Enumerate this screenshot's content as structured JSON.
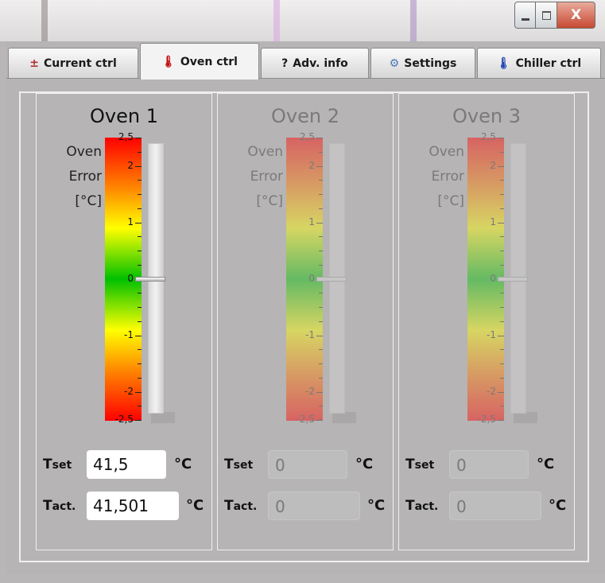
{
  "window": {
    "buttons": {
      "close_label": "X"
    }
  },
  "tabs": [
    {
      "label": "Current ctrl",
      "icon": "current-icon",
      "glyph": "±"
    },
    {
      "label": "Oven ctrl",
      "icon": "thermometer-red-icon",
      "glyph": "🌡"
    },
    {
      "label": "Adv. info",
      "icon": "question-icon",
      "glyph": "?"
    },
    {
      "label": "Settings",
      "icon": "settings-icon",
      "glyph": "⚙"
    },
    {
      "label": "Chiller ctrl",
      "icon": "thermometer-blue-icon",
      "glyph": "🌡"
    }
  ],
  "active_tab": "Oven ctrl",
  "scale": {
    "label_lines": [
      "Oven",
      "Error",
      "[°C]"
    ],
    "ticks": [
      "2,5",
      "2",
      "1",
      "0",
      "-1",
      "-2",
      "-2,5"
    ],
    "min": -2.5,
    "max": 2.5
  },
  "ovens": [
    {
      "title": "Oven 1",
      "enabled": true,
      "error_value": 0,
      "tset_label": "T",
      "tset_sub": "set",
      "tset_value": "41,5",
      "tset_unit": "°C",
      "tact_label": "T",
      "tact_sub": "act.",
      "tact_value": "41,501",
      "tact_unit": "°C"
    },
    {
      "title": "Oven 2",
      "enabled": false,
      "error_value": 0,
      "tset_label": "T",
      "tset_sub": "set",
      "tset_value": "0",
      "tset_unit": "°C",
      "tact_label": "T",
      "tact_sub": "act.",
      "tact_value": "0",
      "tact_unit": "°C"
    },
    {
      "title": "Oven 3",
      "enabled": false,
      "error_value": 0,
      "tset_label": "T",
      "tset_sub": "set",
      "tset_value": "0",
      "tset_unit": "°C",
      "tact_label": "T",
      "tact_sub": "act.",
      "tact_value": "0",
      "tact_unit": "°C"
    }
  ],
  "colors": {
    "scale_top": "#ff0000",
    "scale_mid": "#00c000",
    "close_button": "#c84a32"
  }
}
